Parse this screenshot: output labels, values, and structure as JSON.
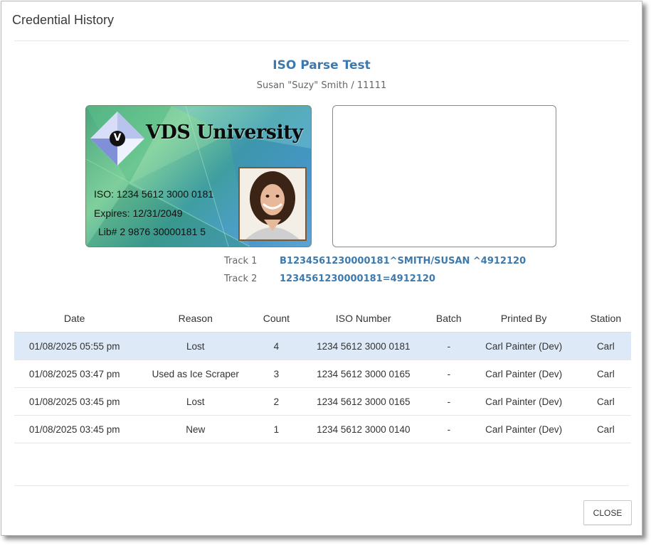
{
  "dialog": {
    "title": "Credential History",
    "heading": "ISO Parse Test",
    "subheading": "Susan \"Suzy\" Smith / 11111",
    "close_label": "CLOSE"
  },
  "card": {
    "university": "VDS University",
    "logo_letter": "V",
    "iso_line": "ISO: 1234 5612 3000 0181",
    "expires_line": "Expires: 12/31/2049",
    "lib_line": "Lib# 2 9876 30000181 5"
  },
  "tracks": [
    {
      "label": "Track 1",
      "value": "B1234561230000181^SMITH/SUSAN ^4912120"
    },
    {
      "label": "Track 2",
      "value": "1234561230000181=4912120"
    }
  ],
  "table": {
    "headers": [
      "Date",
      "Reason",
      "Count",
      "ISO Number",
      "Batch",
      "Printed By",
      "Station"
    ],
    "rows": [
      [
        "01/08/2025 05:55 pm",
        "Lost",
        "4",
        "1234 5612 3000 0181",
        "-",
        "Carl Painter (Dev)",
        "Carl"
      ],
      [
        "01/08/2025 03:47 pm",
        "Used as Ice Scraper",
        "3",
        "1234 5612 3000 0165",
        "-",
        "Carl Painter (Dev)",
        "Carl"
      ],
      [
        "01/08/2025 03:45 pm",
        "Lost",
        "2",
        "1234 5612 3000 0165",
        "-",
        "Carl Painter (Dev)",
        "Carl"
      ],
      [
        "01/08/2025 03:45 pm",
        "New",
        "1",
        "1234 5612 3000 0140",
        "-",
        "Carl Painter (Dev)",
        "Carl"
      ]
    ]
  },
  "colors": {
    "accent": "#3d79ad",
    "selected_row": "#dde9f6"
  }
}
